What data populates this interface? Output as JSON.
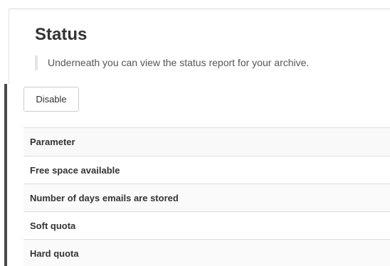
{
  "header": {
    "title": "Status",
    "description": "Underneath you can view the status report for your archive."
  },
  "toolbar": {
    "disable_label": "Disable"
  },
  "table": {
    "header": "Parameter",
    "rows": [
      "Free space available",
      "Number of days emails are stored",
      "Soft quota",
      "Hard quota"
    ]
  }
}
